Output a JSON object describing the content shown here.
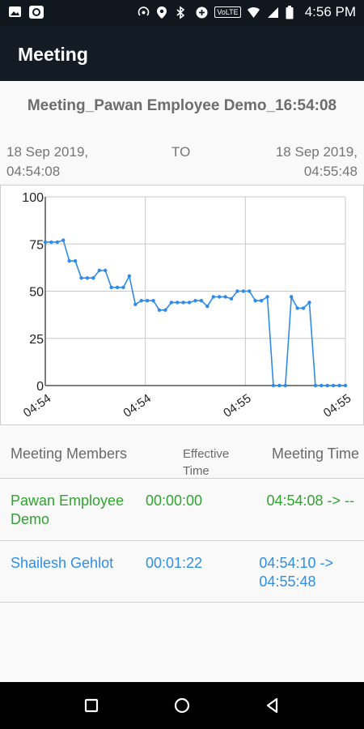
{
  "status_bar": {
    "time": "4:56 PM",
    "icons": [
      "image-icon",
      "record-icon",
      "hotspot-icon",
      "location-icon",
      "bluetooth-icon",
      "data-saver-icon",
      "volte-icon",
      "wifi-icon",
      "signal-icon",
      "battery-icon"
    ],
    "volte_label": "VoLTE"
  },
  "app_bar": {
    "title": "Meeting"
  },
  "meeting": {
    "title": "Meeting_Pawan Employee Demo_16:54:08",
    "start_date": "18 Sep 2019,",
    "start_time": "04:54:08",
    "separator": "TO",
    "end_date": "18 Sep 2019,",
    "end_time": "04:55:48"
  },
  "chart_data": {
    "type": "line",
    "title": "",
    "xlabel": "",
    "ylabel": "",
    "ylim": [
      0,
      100
    ],
    "y_ticks": [
      "0",
      "25",
      "50",
      "75",
      "100"
    ],
    "x_ticks": [
      "04:54",
      "04:54",
      "04:55",
      "04:55"
    ],
    "grid": true,
    "line_color": "#2e8be6",
    "series": [
      {
        "values": [
          76,
          76,
          76,
          77,
          66,
          66,
          57,
          57,
          57,
          61,
          61,
          52,
          52,
          52,
          58,
          43,
          45,
          45,
          45,
          40,
          40,
          44,
          44,
          44,
          44,
          45,
          45,
          42,
          47,
          47,
          47,
          46,
          50,
          50,
          50,
          45,
          45,
          47,
          0,
          0,
          0,
          47,
          41,
          41,
          44,
          0,
          0,
          0,
          0,
          0,
          0
        ]
      }
    ]
  },
  "members": {
    "headers": {
      "members": "Meeting Members",
      "effective_line1": "Effective",
      "effective_line2": "Time",
      "time": "Meeting Time"
    },
    "rows": [
      {
        "name_line1": "Pawan Employee",
        "name_line2": "Demo",
        "effective": "00:00:00",
        "time_line1": "04:54:08 -> --",
        "time_line2": "",
        "color": "#2fa52f"
      },
      {
        "name_line1": "Shailesh Gehlot",
        "name_line2": "",
        "effective": "00:01:22",
        "time_line1": "04:54:10 ->",
        "time_line2": "04:55:48",
        "color": "#2d8fe6"
      }
    ]
  },
  "nav": {
    "buttons": [
      "recents-square-icon",
      "home-circle-icon",
      "back-triangle-icon"
    ]
  }
}
